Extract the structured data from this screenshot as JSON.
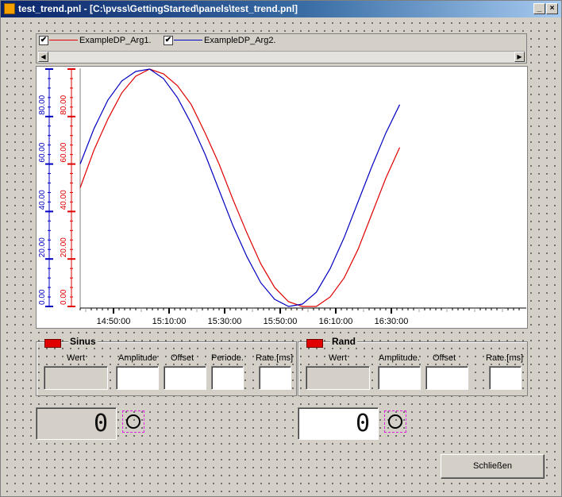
{
  "window": {
    "title": "test_trend.pnl - [C:\\pvss\\GettingStarted\\panels\\test_trend.pnl]",
    "min_glyph": "_",
    "close_glyph": "×"
  },
  "legend": {
    "items": [
      {
        "label": "ExampleDP_Arg1.",
        "color": "#e00000",
        "checked": true
      },
      {
        "label": "ExampleDP_Arg2.",
        "color": "#0000c0",
        "checked": true
      }
    ],
    "check_glyph": "✔",
    "scroll_left": "◀",
    "scroll_right": "▶"
  },
  "chart_data": {
    "type": "line",
    "x_labels": [
      "14:50:00",
      "15:10:00",
      "15:30:00",
      "15:50:00",
      "16:10:00",
      "16:30:00"
    ],
    "y_axes": [
      {
        "color": "#0000c0",
        "ticks": [
          "0.00",
          "20.00",
          "40.00",
          "60.00",
          "80.00",
          "100.00"
        ]
      },
      {
        "color": "#e00000",
        "ticks": [
          "0.00",
          "20.00",
          "40.00",
          "60.00",
          "80.00",
          "100.00"
        ]
      }
    ],
    "ylim": [
      0,
      100
    ],
    "series": [
      {
        "name": "ExampleDP_Arg1.",
        "color": "#e00000",
        "x_min": [
          0,
          5,
          10,
          15,
          20,
          25,
          30,
          35,
          40,
          45,
          50,
          55,
          60,
          65,
          70,
          75,
          80,
          85,
          90,
          95,
          100,
          105,
          110,
          115
        ],
        "values": [
          50,
          66,
          79,
          90,
          97,
          100,
          98,
          93,
          85,
          73,
          60,
          45,
          31,
          18,
          8,
          2,
          0,
          0,
          4,
          12,
          24,
          39,
          54,
          67
        ]
      },
      {
        "name": "ExampleDP_Arg2.",
        "color": "#0000c0",
        "x_min": [
          0,
          5,
          10,
          15,
          20,
          25,
          30,
          35,
          40,
          45,
          50,
          55,
          60,
          65,
          70,
          75,
          80,
          85,
          90,
          95,
          100,
          105,
          110,
          115
        ],
        "values": [
          60,
          75,
          87,
          95,
          99,
          100,
          96,
          88,
          77,
          64,
          49,
          34,
          21,
          10,
          3,
          0,
          1,
          6,
          16,
          29,
          44,
          59,
          73,
          85
        ]
      }
    ]
  },
  "sinus": {
    "title": "Sinus",
    "labels": {
      "wert": "Wert",
      "amplitude": "Amplitude",
      "offset": "Offset",
      "periode": "Periode.",
      "rate": "Rate.[ms]"
    },
    "display_value": "0"
  },
  "rand": {
    "title": "Rand",
    "labels": {
      "wert": "Wert",
      "amplitude": "Amplitude.",
      "offset": "Offset",
      "rate": "Rate.[ms]"
    },
    "display_value": "0"
  },
  "close_button": {
    "label": "Schließen"
  }
}
